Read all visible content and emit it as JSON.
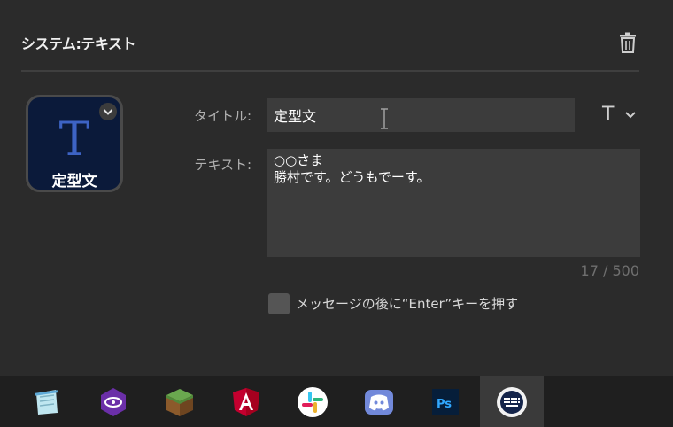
{
  "header": {
    "title": "システム:テキスト"
  },
  "tile": {
    "letter": "T",
    "caption": "定型文"
  },
  "form": {
    "title_label": "タイトル:",
    "title_value": "定型文",
    "text_label": "テキスト:",
    "text_value": "○○さま\n勝村です。どうもでーす。",
    "counter": "17 / 500",
    "checkbox_label": "メッセージの後に“Enter”キーを押す",
    "checkbox_checked": false,
    "format_button_label": "T"
  },
  "taskbar": {
    "apps": [
      "notepad-icon",
      "visual-studio-icon",
      "minecraft-icon",
      "angular-icon",
      "slack-icon",
      "discord-icon",
      "photoshop-icon",
      "keyboard-app-icon"
    ],
    "active_app": "keyboard-app-icon"
  },
  "colors": {
    "panel_bg": "#2b2b2b",
    "input_bg": "#3c3c3c",
    "tile_bg": "#0b1a3a",
    "tile_accent": "#3d63c4"
  }
}
